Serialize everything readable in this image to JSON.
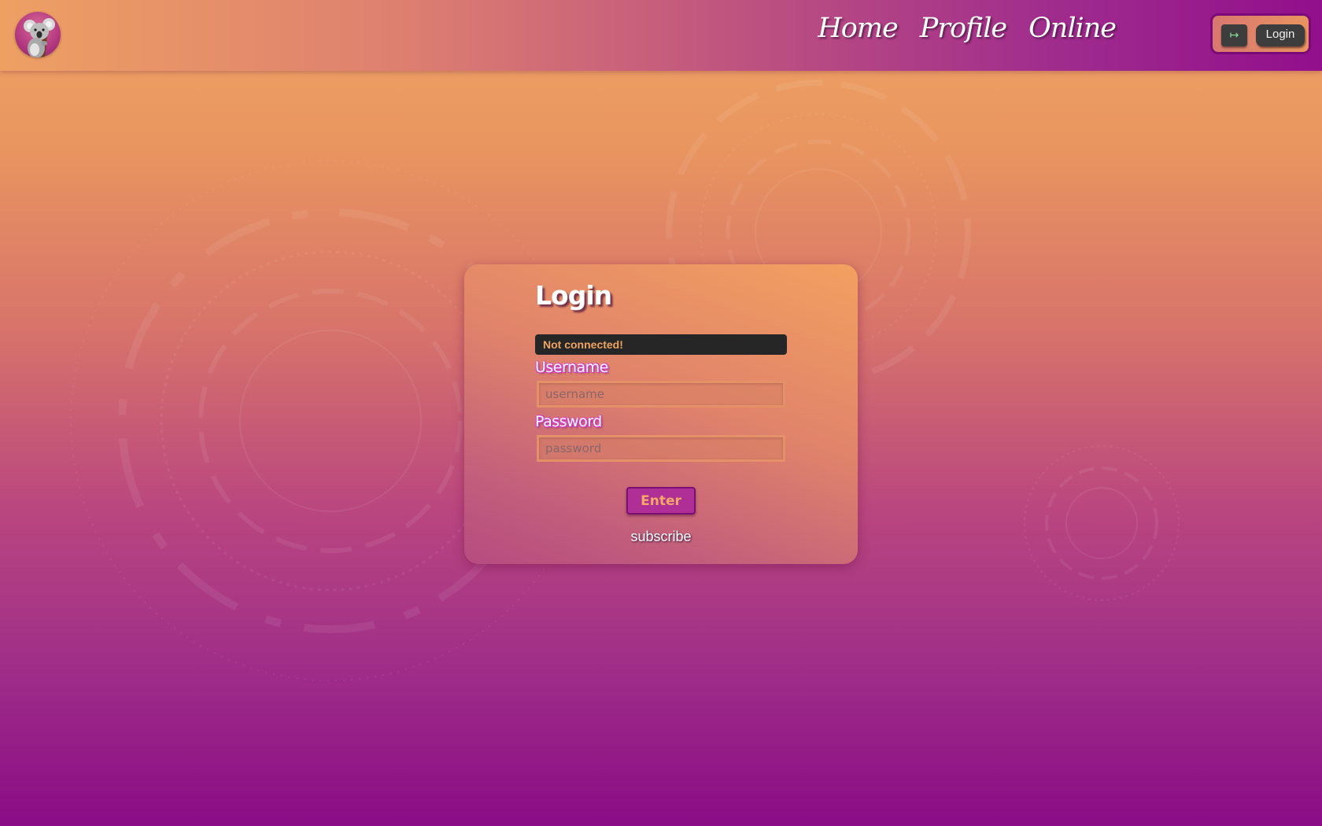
{
  "nav": {
    "items": [
      {
        "label": "Home"
      },
      {
        "label": "Profile"
      },
      {
        "label": "Online"
      }
    ]
  },
  "auth": {
    "icon_glyph": "↦",
    "login_label": "Login"
  },
  "login_card": {
    "title": "Login",
    "status": "Not connected!",
    "username_label": "Username",
    "username_placeholder": "username",
    "username_value": "",
    "password_label": "Password",
    "password_placeholder": "password",
    "password_value": "",
    "enter_label": "Enter",
    "subscribe_label": "subscribe"
  },
  "colors": {
    "status_bg": "#262626",
    "status_text": "#f0a35e",
    "enter_bg": "#b02f96",
    "label_glow": "#d23bcb"
  },
  "icons": {
    "avatar": "koala-avatar",
    "auth_icon": "arrow-right-bar-icon"
  }
}
